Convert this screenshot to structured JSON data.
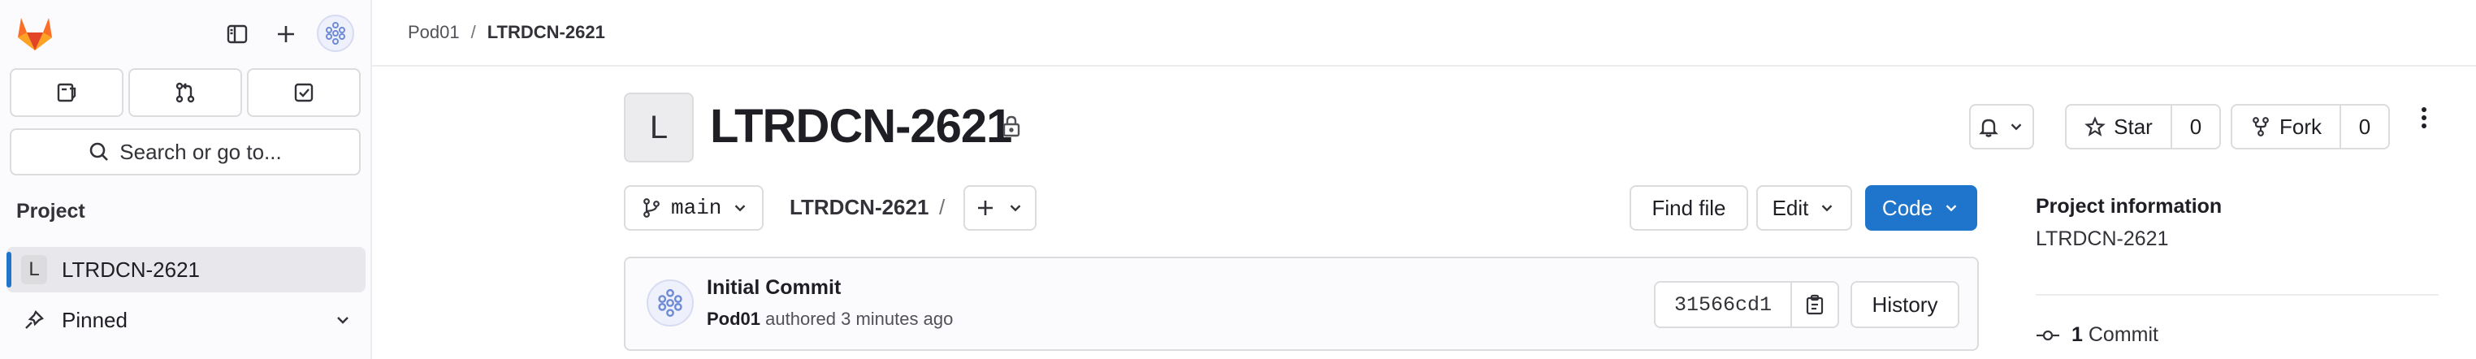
{
  "colors": {
    "accent": "#1f75cb",
    "logo_orange": "#e24329",
    "logo_light_orange": "#fc6d26",
    "logo_yellow": "#fca326"
  },
  "sidebar": {
    "logo": "gitlab-logo",
    "top_icons": [
      "sidebar-toggle-icon",
      "plus-icon",
      "user-avatar"
    ],
    "quick_buttons": [
      "issues-icon",
      "merge-requests-icon",
      "todos-icon"
    ],
    "search_label": "Search or go to...",
    "section_label": "Project",
    "project_item": {
      "badge": "L",
      "label": "LTRDCN-2621"
    },
    "pinned_label": "Pinned"
  },
  "breadcrumb": {
    "items": [
      "Pod01",
      "LTRDCN-2621"
    ],
    "separator": "/"
  },
  "project": {
    "avatar_letter": "L",
    "title": "LTRDCN-2621",
    "visibility_icon": "lock-icon"
  },
  "actions": {
    "star_label": "Star",
    "star_count": "0",
    "fork_label": "Fork",
    "fork_count": "0"
  },
  "toolbar": {
    "branch": "main",
    "path": "LTRDCN-2621",
    "path_sep": "/",
    "find_file": "Find file",
    "edit": "Edit",
    "code": "Code"
  },
  "last_commit": {
    "title": "Initial Commit",
    "author": "Pod01",
    "meta_rest": "authored 3 minutes ago",
    "sha": "31566cd1",
    "history": "History"
  },
  "project_info": {
    "heading": "Project information",
    "name": "LTRDCN-2621",
    "commit_count": "1",
    "commit_label": "Commit"
  }
}
